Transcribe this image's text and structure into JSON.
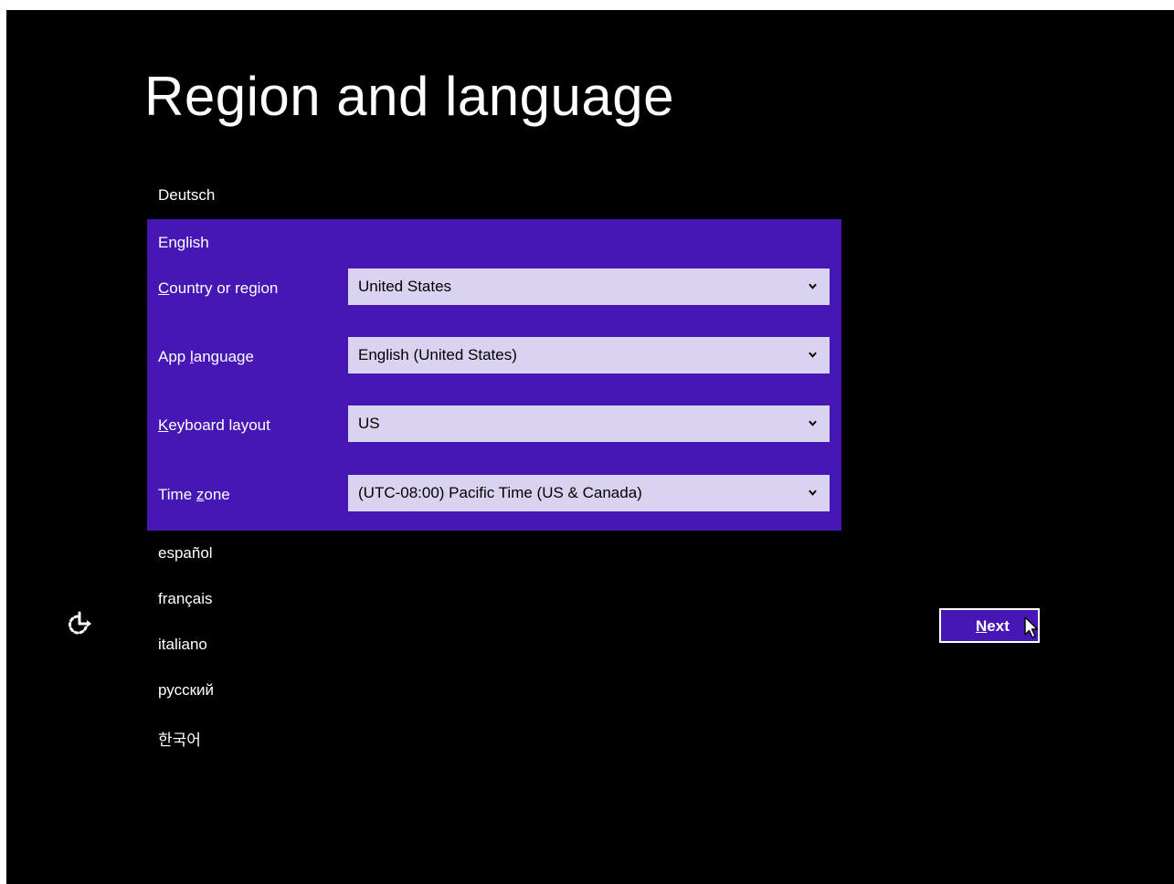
{
  "page": {
    "title": "Region and language"
  },
  "languages_above": [
    {
      "label": "Deutsch"
    }
  ],
  "selected_language": {
    "label": "English",
    "fields": [
      {
        "label_underlined": "C",
        "label_rest": "ountry or region",
        "label_prefix": "",
        "value": "United States"
      },
      {
        "label_prefix": "App ",
        "label_underlined": "l",
        "label_rest": "anguage",
        "value": "English (United States)"
      },
      {
        "label_prefix": "",
        "label_underlined": "K",
        "label_rest": "eyboard layout",
        "value": "US"
      },
      {
        "label_prefix": "Time ",
        "label_underlined": "z",
        "label_rest": "one",
        "value": "(UTC-08:00) Pacific Time (US & Canada)"
      }
    ]
  },
  "languages_below": [
    {
      "label": "español"
    },
    {
      "label": "français"
    },
    {
      "label": "italiano"
    },
    {
      "label": "русский"
    },
    {
      "label": "한국어"
    }
  ],
  "footer": {
    "next_underlined": "N",
    "next_rest": "ext",
    "ease_of_access_icon": "ease-of-access-icon",
    "cursor_icon": "mouse-pointer-icon"
  },
  "colors": {
    "background": "#000000",
    "accent": "#4617b4",
    "select_background": "#dad3f0",
    "text": "#ffffff"
  }
}
